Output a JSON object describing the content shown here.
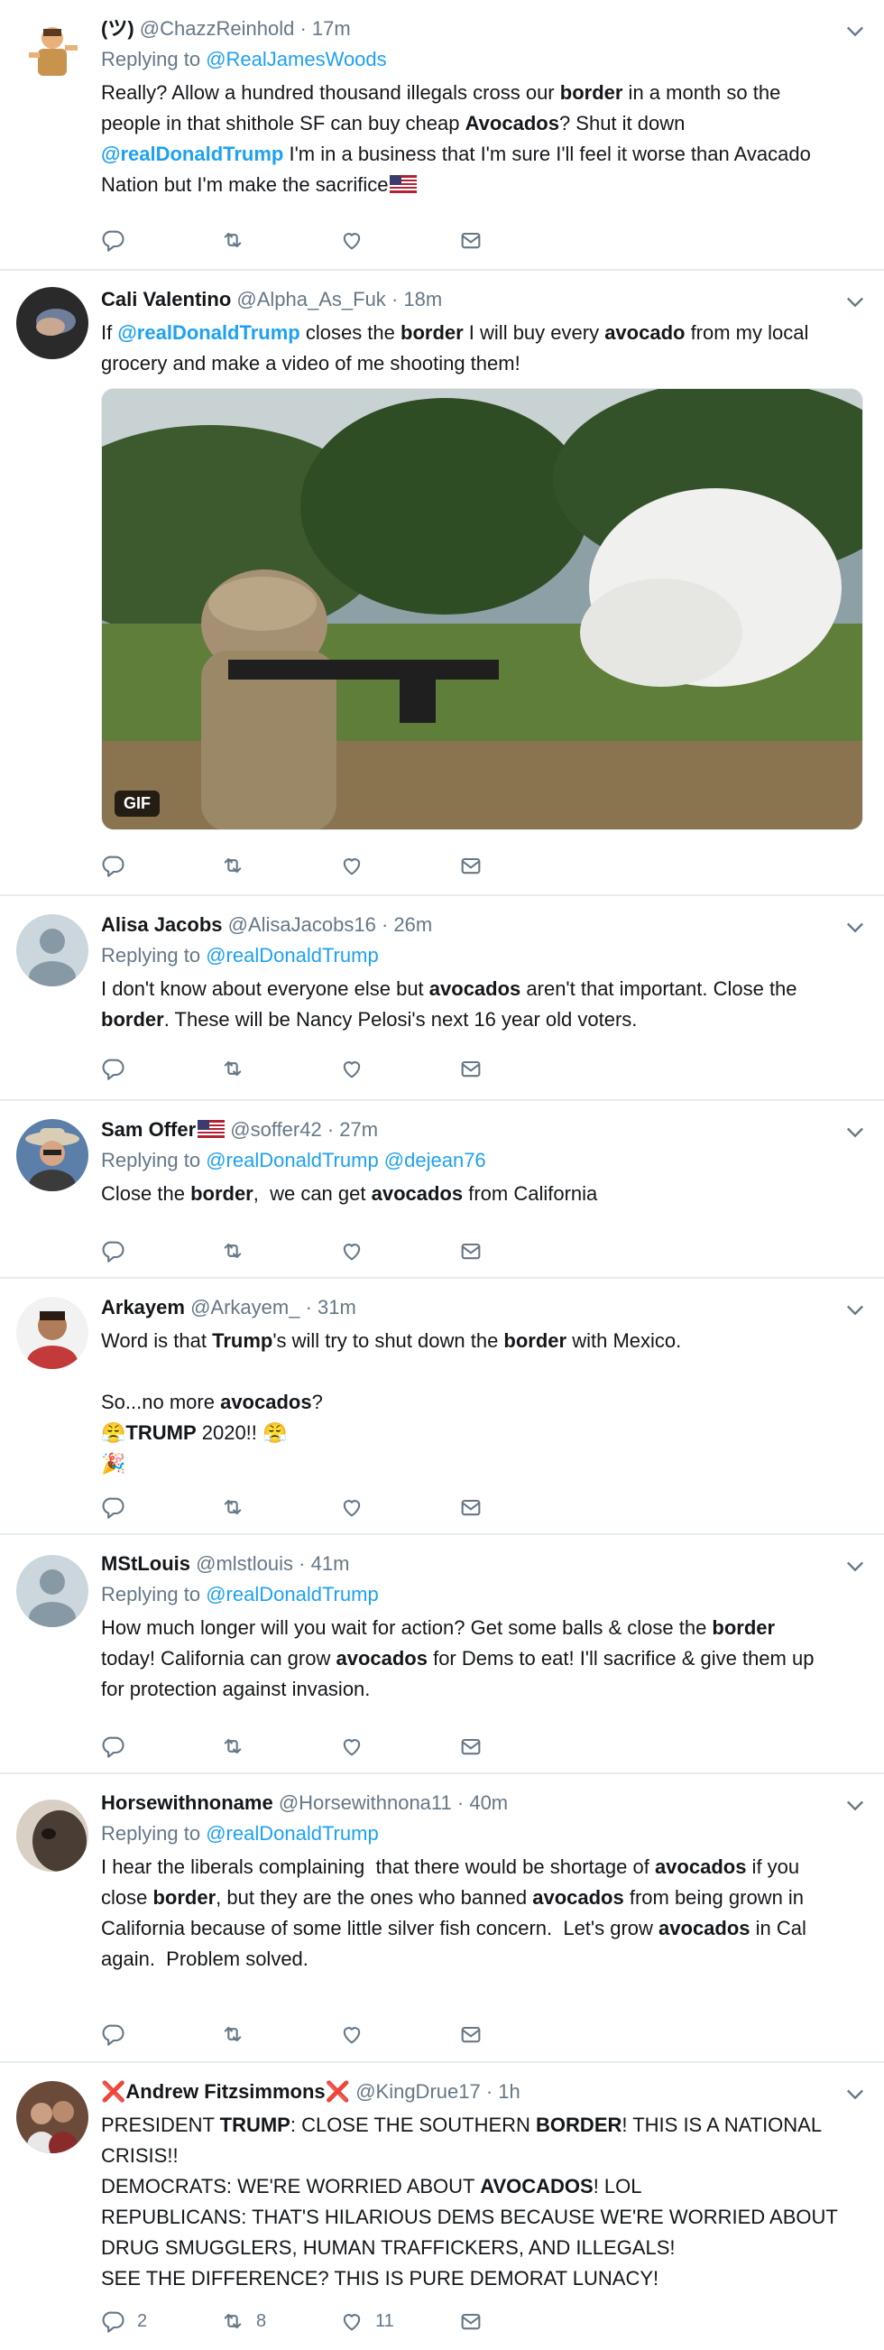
{
  "tweets": [
    {
      "name": "(ツ)",
      "handle": "@ChazzReinhold",
      "time": "17m",
      "reply_prefix": "Replying to",
      "reply_to": "@RealJamesWoods",
      "text_parts": [
        {
          "t": "Really? Allow a hundred thousand illegals cross our "
        },
        {
          "t": "border",
          "b": true
        },
        {
          "t": " in a month so the\npeople in that shithole SF can buy cheap "
        },
        {
          "t": "Avocados",
          "b": true
        },
        {
          "t": "? Shut it down\n"
        },
        {
          "t": "@realDonaldTrump",
          "m": true
        },
        {
          "t": " I'm in a business that I'm sure I'll feel it worse than Avacado\nNation but I'm make the sacrifice"
        }
      ],
      "flag_after_text": true,
      "counts": {
        "reply": "",
        "retweet": "",
        "like": ""
      }
    },
    {
      "name": "Cali Valentino",
      "handle": "@Alpha_As_Fuk",
      "time": "18m",
      "text_parts": [
        {
          "t": "If "
        },
        {
          "t": "@realDonaldTrump",
          "m": true
        },
        {
          "t": " closes the "
        },
        {
          "t": "border",
          "b": true
        },
        {
          "t": " I will buy every "
        },
        {
          "t": "avocado",
          "b": true
        },
        {
          "t": " from my local\ngrocery and make a video of me shooting them!"
        }
      ],
      "media_badge": "GIF",
      "counts": {
        "reply": "",
        "retweet": "",
        "like": ""
      }
    },
    {
      "name": "Alisa Jacobs",
      "handle": "@AlisaJacobs16",
      "time": "26m",
      "reply_prefix": "Replying to",
      "reply_to": "@realDonaldTrump",
      "text_parts": [
        {
          "t": "I don't know about everyone else but "
        },
        {
          "t": "avocados",
          "b": true
        },
        {
          "t": " aren't that important. Close the\n"
        },
        {
          "t": "border",
          "b": true
        },
        {
          "t": ". These will be Nancy Pelosi's next 16 year old voters."
        }
      ],
      "counts": {
        "reply": "",
        "retweet": "",
        "like": ""
      }
    },
    {
      "name": "Sam Offer",
      "handle": "@soffer42",
      "time": "27m",
      "reply_prefix": "Replying to",
      "reply_to": "@realDonaldTrump @dejean76",
      "text_parts": [
        {
          "t": "Close the "
        },
        {
          "t": "border",
          "b": true
        },
        {
          "t": ",  we can get "
        },
        {
          "t": "avocados",
          "b": true
        },
        {
          "t": " from California"
        }
      ],
      "counts": {
        "reply": "",
        "retweet": "",
        "like": ""
      }
    },
    {
      "name": "Arkayem",
      "handle": "@Arkayem_",
      "time": "31m",
      "text_parts": [
        {
          "t": "Word is that "
        },
        {
          "t": "Trump",
          "b": true
        },
        {
          "t": "'s will try to shut down the "
        },
        {
          "t": "border",
          "b": true
        },
        {
          "t": " with Mexico.\n\nSo...no more "
        },
        {
          "t": "avocados",
          "b": true
        },
        {
          "t": "?\n😤"
        },
        {
          "t": "TRUMP",
          "b": true
        },
        {
          "t": " 2020!! 😤\n🎉"
        }
      ],
      "counts": {
        "reply": "",
        "retweet": "",
        "like": ""
      }
    },
    {
      "name": "MStLouis",
      "handle": "@mlstlouis",
      "time": "41m",
      "reply_prefix": "Replying to",
      "reply_to": "@realDonaldTrump",
      "text_parts": [
        {
          "t": "How much longer will you wait for action? Get some balls & close the "
        },
        {
          "t": "border",
          "b": true
        },
        {
          "t": "\ntoday! California can grow "
        },
        {
          "t": "avocados",
          "b": true
        },
        {
          "t": " for Dems to eat! I'll sacrifice & give them up\nfor protection against invasion."
        }
      ],
      "counts": {
        "reply": "",
        "retweet": "",
        "like": ""
      }
    },
    {
      "name": "Horsewithnoname",
      "handle": "@Horsewithnona11",
      "time": "40m",
      "reply_prefix": "Replying to",
      "reply_to": "@realDonaldTrump",
      "text_parts": [
        {
          "t": "I hear the liberals complaining  that there would be shortage of "
        },
        {
          "t": "avocados",
          "b": true
        },
        {
          "t": " if you\nclose "
        },
        {
          "t": "border",
          "b": true
        },
        {
          "t": ", but they are the ones who banned "
        },
        {
          "t": "avocados",
          "b": true
        },
        {
          "t": " from being grown in\nCalifornia because of some little silver fish concern.  Let's grow "
        },
        {
          "t": "avocados",
          "b": true
        },
        {
          "t": " in Cal\nagain.  Problem solved."
        }
      ],
      "counts": {
        "reply": "",
        "retweet": "",
        "like": ""
      }
    },
    {
      "name": "Andrew Fitzsimmons",
      "handle": "@KingDrue17",
      "time": "1h",
      "text_parts": [
        {
          "t": "PRESIDENT "
        },
        {
          "t": "TRUMP",
          "b": true
        },
        {
          "t": ": CLOSE THE SOUTHERN "
        },
        {
          "t": "BORDER",
          "b": true
        },
        {
          "t": "! THIS IS A NATIONAL\nCRISIS!!\nDEMOCRATS: WE'RE WORRIED ABOUT "
        },
        {
          "t": "AVOCADOS",
          "b": true
        },
        {
          "t": "! LOL\nREPUBLICANS: THAT'S HILARIOUS DEMS BECAUSE WE'RE WORRIED ABOUT\nDRUG SMUGGLERS, HUMAN TRAFFICKERS, AND ILLEGALS!\nSEE THE DIFFERENCE? THIS IS PURE DEMORAT LUNACY!"
        }
      ],
      "counts": {
        "reply": "2",
        "retweet": "8",
        "like": "11"
      }
    }
  ],
  "name_suffix": {
    "sam_flag": true,
    "andrew_x": "❌"
  },
  "colors": {
    "link": "#1da1f2",
    "muted": "#657786",
    "divider": "#e6ecf0",
    "text": "#14171a"
  },
  "icons": [
    "reply-icon",
    "retweet-icon",
    "like-icon",
    "dm-icon",
    "chevron-down-icon"
  ]
}
